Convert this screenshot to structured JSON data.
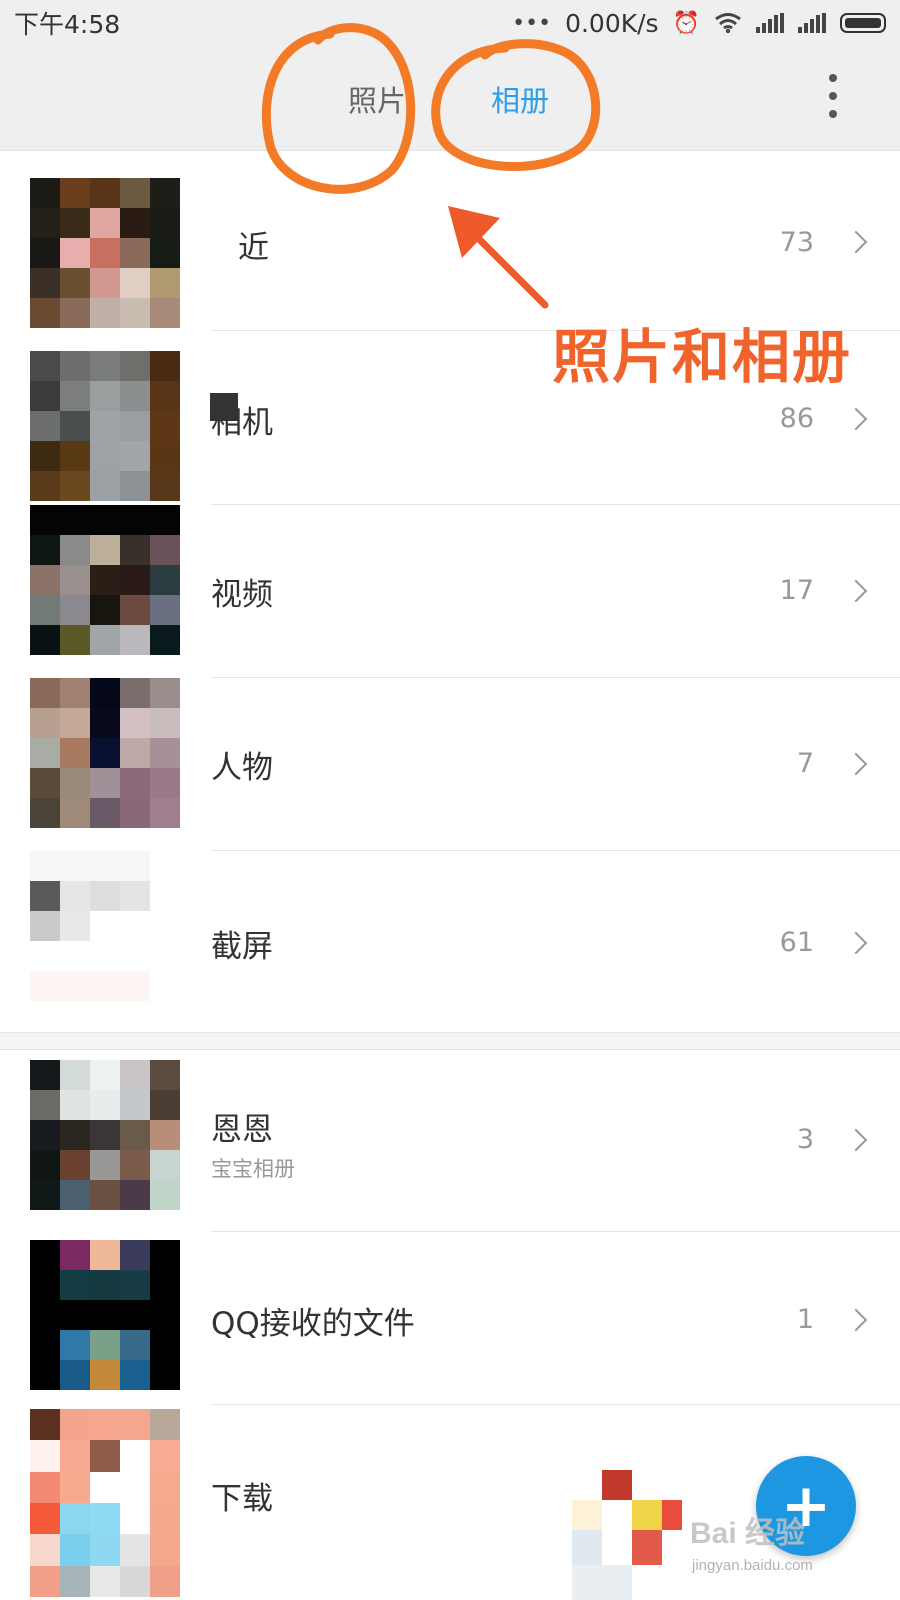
{
  "status_bar": {
    "time": "下午4:58",
    "dots": "•••",
    "net_speed": "0.00K/s"
  },
  "header": {
    "tab_photos": "照片",
    "tab_albums": "相册"
  },
  "annotation": {
    "label": "照片和相册",
    "color": "#f0632a"
  },
  "albums": [
    {
      "title": "近",
      "count": "73"
    },
    {
      "title": "相机",
      "count": "86"
    },
    {
      "title": "视频",
      "count": "17"
    },
    {
      "title": "人物",
      "count": "7"
    },
    {
      "title": "截屏",
      "count": "61"
    },
    {
      "title": "恩恩",
      "subtitle": "宝宝相册",
      "count": "3"
    },
    {
      "title": "QQ接收的文件",
      "count": "1"
    },
    {
      "title": "下载",
      "count": ""
    }
  ],
  "fab": {
    "label": "+",
    "color": "#1d97e1"
  },
  "watermark": {
    "brand": "Bai 经验",
    "url": "jingyan.baidu.com"
  },
  "accent": "#2f9ee6"
}
